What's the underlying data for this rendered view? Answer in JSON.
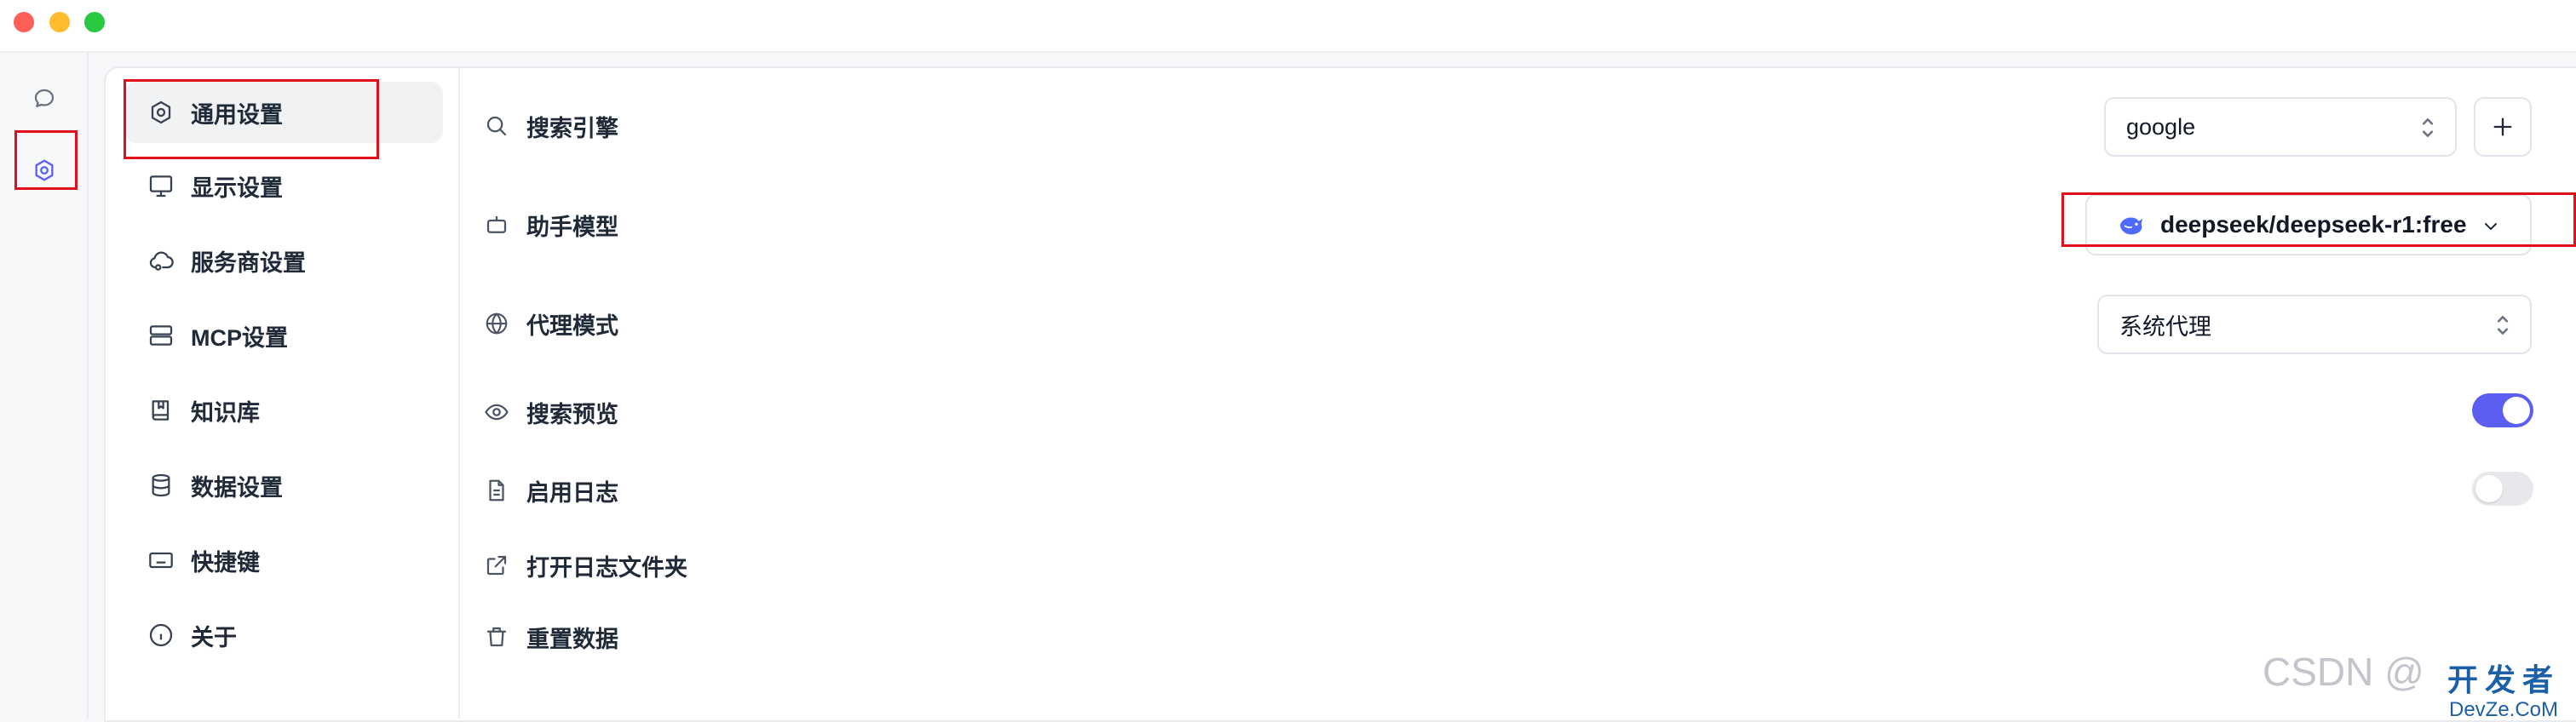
{
  "window_controls": [
    "close",
    "minimize",
    "zoom"
  ],
  "icon_bar": [
    {
      "icon": "chat-bubble-icon",
      "active": false
    },
    {
      "icon": "settings-hexagon-icon",
      "active": true
    }
  ],
  "sidebar": {
    "items": [
      {
        "label": "通用设置",
        "icon": "settings-hexagon-icon",
        "active": true
      },
      {
        "label": "显示设置",
        "icon": "monitor-icon",
        "active": false
      },
      {
        "label": "服务商设置",
        "icon": "cloud-icon",
        "active": false
      },
      {
        "label": "MCP设置",
        "icon": "server-icon",
        "active": false
      },
      {
        "label": "知识库",
        "icon": "book-icon",
        "active": false
      },
      {
        "label": "数据设置",
        "icon": "database-icon",
        "active": false
      },
      {
        "label": "快捷键",
        "icon": "keyboard-icon",
        "active": false
      },
      {
        "label": "关于",
        "icon": "info-icon",
        "active": false
      }
    ]
  },
  "settings": {
    "search_engine": {
      "label": "搜索引擎",
      "value": "google"
    },
    "assistant_model": {
      "label": "助手模型",
      "value": "deepseek/deepseek-r1:free"
    },
    "proxy_mode": {
      "label": "代理模式",
      "value": "系统代理"
    },
    "search_preview": {
      "label": "搜索预览",
      "enabled": true
    },
    "enable_log": {
      "label": "启用日志",
      "enabled": false
    },
    "open_log_folder": {
      "label": "打开日志文件夹"
    },
    "reset_data": {
      "label": "重置数据"
    }
  },
  "colors": {
    "accent": "#5b5ef0",
    "highlight_box": "#e0101a",
    "toggle_off": "#e6e8ec"
  },
  "watermark": {
    "text": "CSDN @",
    "site_cn": "开发者",
    "site_en": "DevZe.CoM"
  }
}
